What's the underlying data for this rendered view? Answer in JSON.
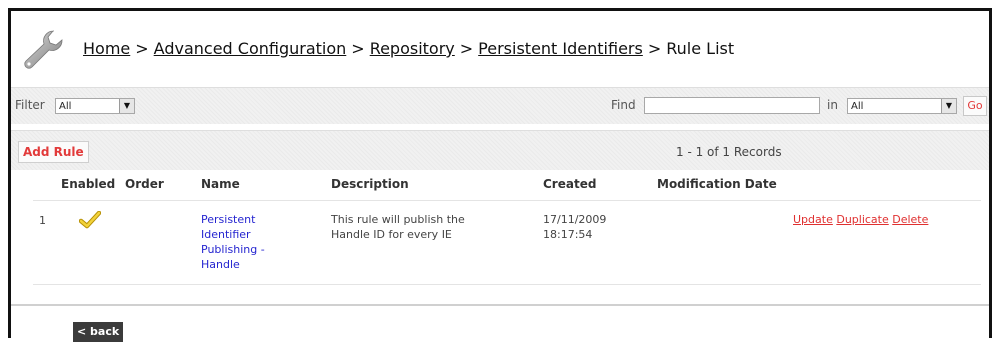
{
  "breadcrumb": {
    "items": [
      "Home",
      "Advanced Configuration",
      "Repository",
      "Persistent Identifiers"
    ],
    "separator": ">",
    "current": "Rule List"
  },
  "filter_bar": {
    "filter_label": "Filter",
    "filter_value": "All",
    "find_label": "Find",
    "find_value": "",
    "in_label": "in",
    "in_value": "All",
    "go_label": "Go"
  },
  "actions": {
    "add_rule_label": "Add Rule",
    "records_text": "1 - 1 of 1 Records"
  },
  "table": {
    "headers": [
      "Enabled",
      "Order",
      "Name",
      "Description",
      "Created",
      "Modification Date"
    ],
    "rows": [
      {
        "index": "1",
        "enabled_icon": "checkmark-icon",
        "order": "",
        "name_lines": [
          "Persistent",
          "Identifier",
          "Publishing -",
          "Handle"
        ],
        "description_lines": [
          "This rule will publish the",
          "Handle ID for every IE"
        ],
        "created_lines": [
          "17/11/2009",
          "18:17:54"
        ],
        "modification_date": "",
        "actions": [
          "Update",
          "Duplicate",
          "Delete"
        ]
      }
    ]
  },
  "footer": {
    "back_label": "< back"
  },
  "colors": {
    "link_blue": "#2525d0",
    "action_red": "#e03030",
    "checkmark": "#e8c21a"
  },
  "icons": {
    "header": "wrench-icon",
    "dropdown": "chevron-down-icon"
  }
}
